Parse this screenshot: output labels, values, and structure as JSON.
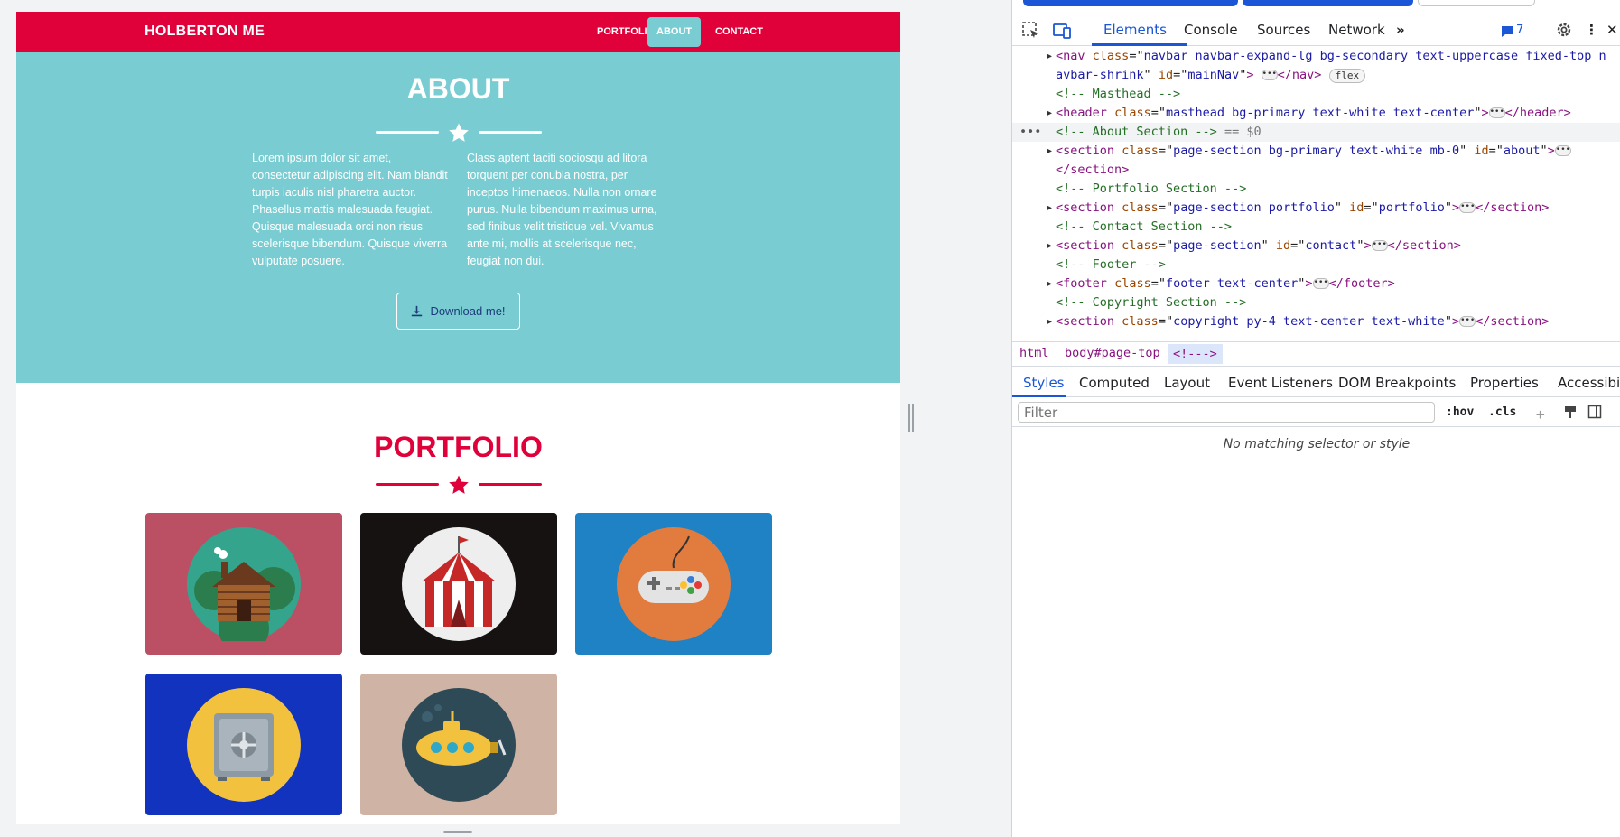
{
  "site": {
    "brand": "HOLBERTON ME",
    "nav": [
      "PORTFOLIO",
      "ABOUT",
      "CONTACT"
    ],
    "about": {
      "title": "ABOUT",
      "col1": "Lorem ipsum dolor sit amet, consectetur adipiscing elit. Nam blandit turpis iaculis nisl pharetra auctor. Phasellus mattis malesuada feugiat. Quisque malesuada orci non risus scelerisque bibendum. Quisque viverra vulputate posuere.",
      "col2": "Class aptent taciti sociosqu ad litora torquent per conubia nostra, per inceptos himenaeos. Nulla non ornare purus. Nulla bibendum maximus urna, sed finibus velit tristique vel. Vivamus ante mi, mollis at scelerisque nec, feugiat non dui.",
      "button": "Download me!"
    },
    "portfolio": {
      "title": "PORTFOLIO",
      "items": [
        {
          "icon": "cabin-icon",
          "bg": "#bb5065"
        },
        {
          "icon": "circus-tent-icon",
          "bg": "#161212"
        },
        {
          "icon": "game-controller-icon",
          "bg": "#1e82c4"
        },
        {
          "icon": "safe-icon",
          "bg": "#1233bd"
        },
        {
          "icon": "submarine-icon",
          "bg": "#cfb3a5"
        }
      ]
    },
    "colors": {
      "primary": "#e0003a",
      "secondary": "#79cdd2"
    }
  },
  "devtools": {
    "tabs": [
      "Elements",
      "Console",
      "Sources",
      "Network"
    ],
    "issues_count": "7",
    "dom": {
      "nav_tag": "nav",
      "nav_class_attr": "class",
      "nav_class_val": "navbar navbar-expand-lg bg-secondary text-uppercase fixed-top n",
      "nav_line2_val": "avbar-shrink",
      "nav_id_attr": "id",
      "nav_id_val": "mainNav",
      "nav_badge": "flex",
      "comment_masthead": "<!-- Masthead -->",
      "header_tag": "header",
      "header_class_val": "masthead bg-primary text-white text-center",
      "comment_about": "<!-- About Section -->",
      "selected_marker": "== $0",
      "about_tag": "section",
      "about_class_val": "page-section bg-primary text-white mb-0",
      "about_id_val": "about",
      "about_close": "</section>",
      "comment_portfolio": "<!-- Portfolio Section -->",
      "portfolio_class_val": "page-section portfolio",
      "portfolio_id_val": "portfolio",
      "comment_contact": "<!-- Contact Section -->",
      "contact_class_val": "page-section",
      "contact_id_val": "contact",
      "comment_footer": "<!-- Footer -->",
      "footer_tag": "footer",
      "footer_class_val": "footer text-center",
      "comment_copyright": "<!-- Copyright Section -->",
      "copyright_class_val": "copyright py-4 text-center text-white"
    },
    "breadcrumbs": [
      "html",
      "body#page-top",
      "<!--->"
    ],
    "style_tabs": [
      "Styles",
      "Computed",
      "Layout",
      "Event Listeners",
      "DOM Breakpoints",
      "Properties",
      "Accessibility"
    ],
    "filter_placeholder": "Filter",
    "hov": ":hov",
    "cls": ".cls",
    "empty_message": "No matching selector or style"
  }
}
